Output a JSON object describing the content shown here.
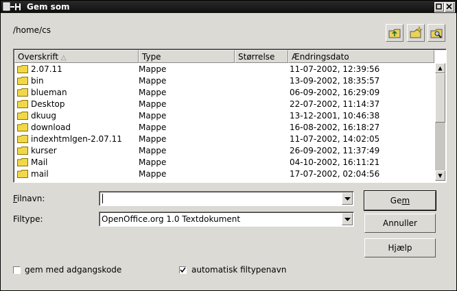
{
  "window": {
    "title": "Gem som"
  },
  "location": {
    "path": "/home/cs"
  },
  "toolbar": {
    "up_icon": "folder-up-icon",
    "new_folder_icon": "new-folder-icon",
    "browse_icon": "folder-browse-icon"
  },
  "file_list": {
    "columns": [
      "Overskrift",
      "Type",
      "Størrelse",
      "Ændringsdato"
    ],
    "sort_indicator": "△",
    "rows": [
      {
        "name": "2.07.11",
        "type": "Mappe",
        "size": "",
        "date": "11-07-2002, 12:39:56"
      },
      {
        "name": "bin",
        "type": "Mappe",
        "size": "",
        "date": "13-09-2002, 18:35:57"
      },
      {
        "name": "blueman",
        "type": "Mappe",
        "size": "",
        "date": "06-09-2002, 16:29:09"
      },
      {
        "name": "Desktop",
        "type": "Mappe",
        "size": "",
        "date": "22-07-2002, 11:14:37"
      },
      {
        "name": "dkuug",
        "type": "Mappe",
        "size": "",
        "date": "13-12-2001, 10:46:38"
      },
      {
        "name": "download",
        "type": "Mappe",
        "size": "",
        "date": "16-08-2002, 16:18:27"
      },
      {
        "name": "indexhtmlgen-2.07.11",
        "type": "Mappe",
        "size": "",
        "date": "11-07-2002, 14:02:05"
      },
      {
        "name": "kurser",
        "type": "Mappe",
        "size": "",
        "date": "26-09-2002, 11:37:49"
      },
      {
        "name": "Mail",
        "type": "Mappe",
        "size": "",
        "date": "04-10-2002, 16:11:21"
      },
      {
        "name": "mail",
        "type": "Mappe",
        "size": "",
        "date": "17-07-2002, 02:04:56"
      }
    ]
  },
  "form": {
    "filename_label_u": "F",
    "filename_label_rest": "ilnavn:",
    "filename_value": "",
    "filetype_label": "Filtype:",
    "filetype_value": "OpenOffice.org 1.0 Textdokument"
  },
  "buttons": {
    "save_a": "Ge",
    "save_u": "m",
    "save_b": "",
    "cancel": "Annuller",
    "help_a": "H",
    "help_u": "j",
    "help_b": "ælp"
  },
  "options": {
    "password_label": "gem med adgangskode",
    "password_checked": false,
    "autoext_label": "automatisk filtypenavn",
    "autoext_checked": true
  }
}
